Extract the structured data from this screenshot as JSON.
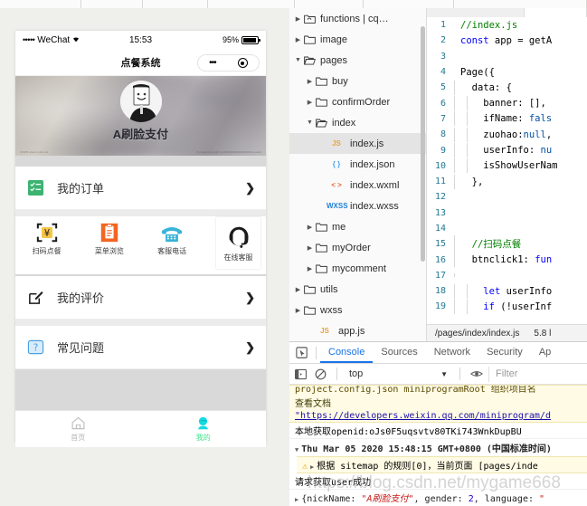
{
  "window": {
    "top_tabs": [
      90,
      68,
      72,
      96,
      76,
      100,
      147
    ]
  },
  "simulator": {
    "statusbar": {
      "signal": "•••••",
      "carrier": "WeChat",
      "wifi": "◥",
      "time": "15:53",
      "battery_pct": "95%"
    },
    "navbar": {
      "title": "点餐系统",
      "capsule_dots": "•••",
      "capsule_target": "target-icon"
    },
    "hero": {
      "user_name": "A刷脸支付",
      "fine_left": "CSDN  www.csdn.net",
      "fine_right": "flyingbird.png@!cdn0000000000000000/a.cadn"
    },
    "rows": [
      {
        "icon": "order-list-icon",
        "label": "我的订单",
        "chevron": "❯"
      },
      {
        "icon": "edit-square-icon",
        "label": "我的评价",
        "chevron": "❯"
      },
      {
        "icon": "question-mark-icon",
        "label": "常见问题",
        "chevron": "❯"
      }
    ],
    "quick": [
      {
        "icon": "scan-yuan-icon",
        "label": "扫码点餐"
      },
      {
        "icon": "menu-clipboard-icon",
        "label": "菜单浏览"
      },
      {
        "icon": "telephone-icon",
        "label": "客服电话"
      }
    ],
    "quick_float": {
      "icon": "headset-support-icon",
      "label": "在线客服"
    },
    "tabbar": [
      {
        "icon": "home-icon",
        "label": "首页",
        "active": false
      },
      {
        "icon": "profile-icon",
        "label": "我的",
        "active": true
      }
    ],
    "accent_active": "#3fe38a",
    "accent_tab_icon": "#16dbe0"
  },
  "file_tree": [
    {
      "depth": 0,
      "arrow": "▶",
      "icon": "cloud-folder-icon",
      "label": "functions | cq…",
      "selected": false
    },
    {
      "depth": 0,
      "arrow": "▶",
      "icon": "folder-icon",
      "label": "image",
      "selected": false
    },
    {
      "depth": 0,
      "arrow": "▼",
      "icon": "folder-open-icon",
      "label": "pages",
      "selected": false
    },
    {
      "depth": 1,
      "arrow": "▶",
      "icon": "folder-icon",
      "label": "buy",
      "selected": false
    },
    {
      "depth": 1,
      "arrow": "▶",
      "icon": "folder-icon",
      "label": "confirmOrder",
      "selected": false
    },
    {
      "depth": 1,
      "arrow": "▼",
      "icon": "folder-open-icon",
      "label": "index",
      "selected": false
    },
    {
      "depth": 2,
      "arrow": "",
      "icon": "js-file-icon",
      "ftype": "JS",
      "ftype_color": "#e8a33d",
      "label": "index.js",
      "selected": true
    },
    {
      "depth": 2,
      "arrow": "",
      "icon": "json-file-icon",
      "ftype": "{ }",
      "ftype_color": "#4ea1e8",
      "label": "index.json",
      "selected": false
    },
    {
      "depth": 2,
      "arrow": "",
      "icon": "wxml-file-icon",
      "ftype": "< >",
      "ftype_color": "#e8653d",
      "label": "index.wxml",
      "selected": false
    },
    {
      "depth": 2,
      "arrow": "",
      "icon": "wxss-file-icon",
      "ftype": "WXSS",
      "ftype_color": "#1f7fd6",
      "label": "index.wxss",
      "selected": false
    },
    {
      "depth": 1,
      "arrow": "▶",
      "icon": "folder-icon",
      "label": "me",
      "selected": false
    },
    {
      "depth": 1,
      "arrow": "▶",
      "icon": "folder-icon",
      "label": "myOrder",
      "selected": false
    },
    {
      "depth": 1,
      "arrow": "▶",
      "icon": "folder-icon",
      "label": "mycomment",
      "selected": false
    },
    {
      "depth": 0,
      "arrow": "▶",
      "icon": "folder-icon",
      "label": "utils",
      "selected": false
    },
    {
      "depth": 0,
      "arrow": "▶",
      "icon": "folder-icon",
      "label": "wxss",
      "selected": false
    },
    {
      "depth": 1,
      "arrow": "",
      "icon": "js-file-icon",
      "ftype": "JS",
      "ftype_color": "#e8a33d",
      "label": "app.js",
      "selected": false
    }
  ],
  "editor": {
    "lines": [
      {
        "n": "1",
        "indent": 0,
        "html": "<span class='cm'>//index.js</span>"
      },
      {
        "n": "2",
        "indent": 0,
        "html": "<span class='kw'>const</span> app = getA"
      },
      {
        "n": "3",
        "indent": 0,
        "html": ""
      },
      {
        "n": "4",
        "indent": 0,
        "html": "Page({"
      },
      {
        "n": "5",
        "indent": 1,
        "html": "  data: {"
      },
      {
        "n": "6",
        "indent": 2,
        "html": "    banner: [],"
      },
      {
        "n": "7",
        "indent": 2,
        "html": "    ifName: <span class='lit'>fals</span>"
      },
      {
        "n": "8",
        "indent": 2,
        "html": "    zuohao:<span class='lit'>null</span>,"
      },
      {
        "n": "9",
        "indent": 2,
        "html": "    userInfo: <span class='lit'>nu</span>"
      },
      {
        "n": "10",
        "indent": 2,
        "html": "    isShowUserNam"
      },
      {
        "n": "11",
        "indent": 1,
        "html": "  },"
      },
      {
        "n": "12",
        "indent": 0,
        "html": ""
      },
      {
        "n": "13",
        "indent": 0,
        "html": ""
      },
      {
        "n": "14",
        "indent": 0,
        "html": ""
      },
      {
        "n": "15",
        "indent": 1,
        "html": "  <span class='cm'>//扫码点餐</span>"
      },
      {
        "n": "16",
        "indent": 1,
        "html": "  btnclick1: <span class='kw'>fun</span>"
      },
      {
        "n": "17",
        "indent": 1,
        "html": ""
      },
      {
        "n": "18",
        "indent": 2,
        "html": "    <span class='kw'>let</span> userInfo"
      },
      {
        "n": "19",
        "indent": 2,
        "html": "    <span class='kw'>if</span> (!userInf"
      }
    ],
    "status": {
      "path": "/pages/index/index.js",
      "size": "5.8 l"
    }
  },
  "devtools": {
    "inspector_icon": "inspect-element-icon",
    "tabs": [
      {
        "label": "Console",
        "active": true
      },
      {
        "label": "Sources",
        "active": false
      },
      {
        "label": "Network",
        "active": false
      },
      {
        "label": "Security",
        "active": false
      },
      {
        "label": "Ap",
        "active": false
      }
    ],
    "toolbar": {
      "sidebar_icon": "show-console-sidebar-icon",
      "clear_icon": "clear-console-icon",
      "context": "top",
      "context_caret": "▼",
      "eye_icon": "live-expression-icon",
      "filter_placeholder": "Filter"
    },
    "messages": [
      {
        "type": "warn-clipped",
        "text": "project.config.json  miniprogramRoot  组织项目名"
      },
      {
        "type": "warn-link-label",
        "text": "查看文档"
      },
      {
        "type": "warn-link",
        "text": "\"https://developers.weixin.qq.com/miniprogram/d"
      },
      {
        "type": "log",
        "prefix": "本地获取",
        "text": "openid:oJs0F5uqsvtv80TKi743WnkDupBU"
      },
      {
        "type": "group",
        "arrow": "▼",
        "text": "Thu Mar 05 2020 15:48:15 GMT+0800 (中国标准时间)"
      },
      {
        "type": "warning",
        "icon": "warning-triangle-icon",
        "arrow": "▶",
        "text": "根据 sitemap 的规则[0]，当前页面 [pages/inde"
      },
      {
        "type": "log",
        "prefix": "请求获取",
        "text": "user成功"
      },
      {
        "type": "object",
        "arrow": "▶",
        "text": "{nickName: \"A刷脸支付\", gender: 2, language: \""
      }
    ],
    "watermark": "https://blog.csdn.net/mygame668"
  }
}
